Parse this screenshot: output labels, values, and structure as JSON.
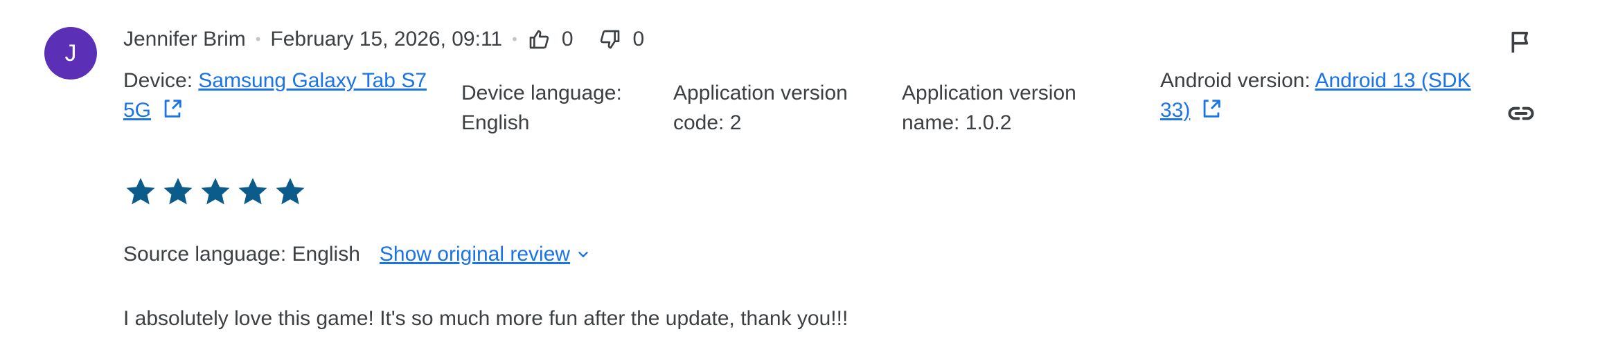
{
  "review": {
    "avatar_initial": "J",
    "author": "Jennifer Brim",
    "separator": "•",
    "date": "February 15, 2026, 09:11",
    "likes": "0",
    "dislikes": "0",
    "rating": 5,
    "rating_max": 5,
    "source_language": "Source language: English",
    "show_original": "Show original review",
    "text": "I absolutely love this game! It's so much more fun after the update, thank you!!!"
  },
  "metadata": {
    "device_label": "Device: ",
    "device_link_line1": "Samsung Galaxy Tab S7",
    "device_link_line2": "5G",
    "device_language_line1": "Device language:",
    "device_language_line2": "English",
    "app_version_code_line1": "Application version",
    "app_version_code_line2": "code: 2",
    "app_version_name_line1": "Application version",
    "app_version_name_line2": "name: 1.0.2",
    "android_label": "Android version: ",
    "android_link_line1": "Android 13 (SDK",
    "android_link_line2": "33)"
  },
  "actions": {
    "flag_icon": "flag-icon",
    "link_icon": "link-icon"
  },
  "colors": {
    "avatar": "#5b2fb6",
    "star": "#0b5c8a",
    "link": "#1a73e8",
    "text": "#3c4043"
  }
}
